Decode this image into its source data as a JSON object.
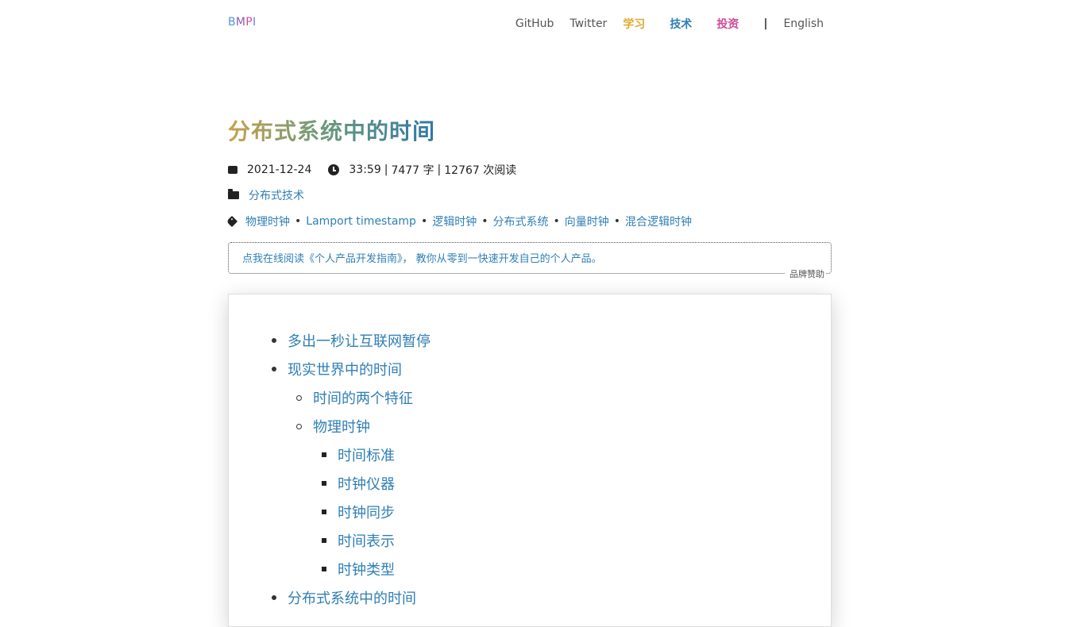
{
  "header": {
    "brand": [
      "B",
      "M",
      "P",
      "I"
    ],
    "nav": [
      {
        "label": "GitHub",
        "color": "#555555"
      },
      {
        "label": "Twitter",
        "color": "#555555"
      },
      {
        "label": "学习",
        "color": "#e0a92d"
      },
      {
        "label": "技术",
        "color": "#2f7fb5"
      },
      {
        "label": "投资",
        "color": "#d04a9a"
      },
      {
        "label": "|",
        "color": "#333333"
      },
      {
        "label": "English",
        "color": "#555555"
      }
    ]
  },
  "post": {
    "title": "分布式系统中的时间",
    "date": "2021-12-24",
    "duration": "33:59",
    "words": "7477 字",
    "reads": "12767 次阅读",
    "category": "分布式技术",
    "tags": [
      "物理时钟",
      "Lamport timestamp",
      "逻辑时钟",
      "分布式系统",
      "向量时钟",
      "混合逻辑时钟"
    ]
  },
  "sponsor": {
    "text": "点我在线阅读《个人产品开发指南》， 教你从零到一快速开发自己的个人产品。",
    "label": "品牌赞助"
  },
  "toc": [
    {
      "label": "多出一秒让互联网暂停",
      "level": 1
    },
    {
      "label": "现实世界中的时间",
      "level": 1
    },
    {
      "label": "时间的两个特征",
      "level": 2
    },
    {
      "label": "物理时钟",
      "level": 2
    },
    {
      "label": "时间标准",
      "level": 3
    },
    {
      "label": "时钟仪器",
      "level": 3
    },
    {
      "label": "时钟同步",
      "level": 3
    },
    {
      "label": "时间表示",
      "level": 3
    },
    {
      "label": "时钟类型",
      "level": 3
    },
    {
      "label": "分布式系统中的时间",
      "level": 1
    }
  ]
}
